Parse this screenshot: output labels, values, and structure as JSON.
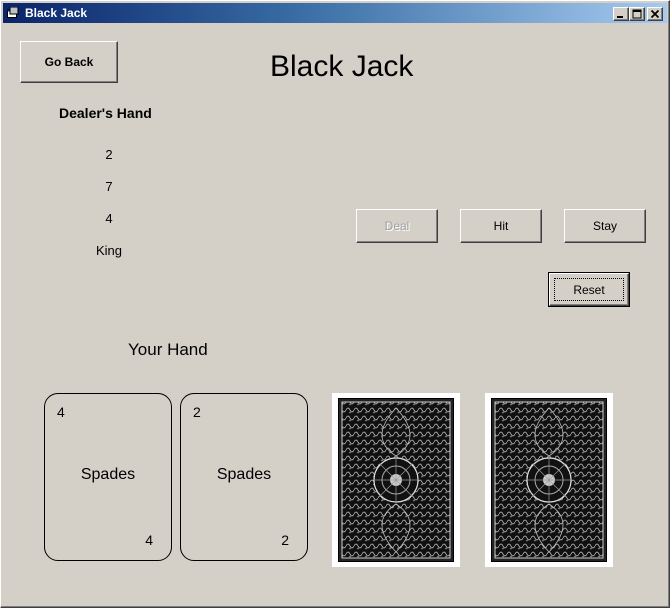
{
  "window": {
    "title": "Black Jack",
    "controls": [
      "minimize-icon",
      "maximize-icon",
      "close-icon"
    ]
  },
  "toolbar": {
    "go_back_label": "Go Back"
  },
  "header": {
    "title": "Black Jack"
  },
  "dealer": {
    "title": "Dealer's Hand",
    "cards": [
      "2",
      "7",
      "4",
      "King"
    ]
  },
  "actions": {
    "deal_label": "Deal",
    "hit_label": "Hit",
    "stay_label": "Stay",
    "reset_label": "Reset"
  },
  "player": {
    "title": "Your Hand",
    "cards": [
      {
        "rank": "4",
        "suit": "Spades"
      },
      {
        "rank": "2",
        "suit": "Spades"
      }
    ],
    "face_down_cards": 2
  },
  "colors": {
    "face": "#d4d0c8",
    "titlebar_start": "#0a246a",
    "titlebar_end": "#a6caf0"
  }
}
